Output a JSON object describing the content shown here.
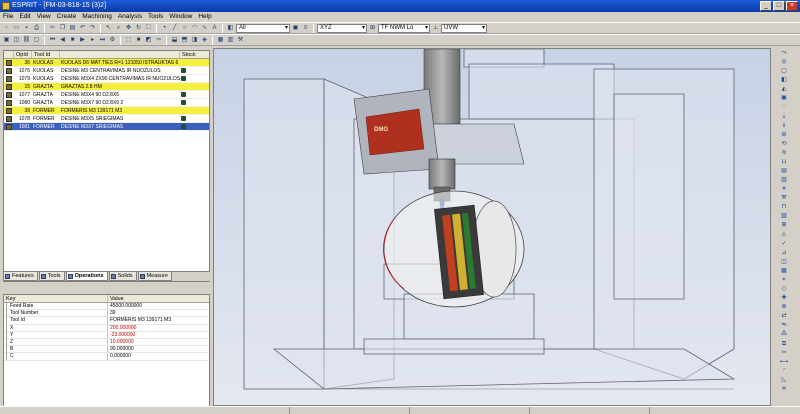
{
  "window": {
    "title": "ESPRIT - [FM-03-818-15 (3)2]",
    "buttons": [
      "_",
      "□",
      "×"
    ]
  },
  "menu": [
    "File",
    "Edit",
    "View",
    "Create",
    "Machining",
    "Analysis",
    "Tools",
    "Window",
    "Help"
  ],
  "toolbar": {
    "layer_combo": "All",
    "plane_combo": "XYZ",
    "view_combo": "TF NWM Lo",
    "uvw_combo": "UVW"
  },
  "operations": {
    "columns": [
      "OpId",
      "Tool Id",
      "",
      "Stock"
    ],
    "rows": [
      {
        "opid": "36",
        "tool": "KUOLAS",
        "name": "KUOLAS D6 MAT TIES R=1 121050 ISTRAUKTAS 6",
        "stock": false,
        "style": "yellow"
      },
      {
        "opid": "1076",
        "tool": "KUOLAS",
        "name": "DESINE M3 CENTRAVIMAS IR NUOZULOS",
        "stock": true,
        "style": ""
      },
      {
        "opid": "1079",
        "tool": "KUOLAS",
        "name": "DESINE M3X4 ZX90 CENTRAVIMAS IR NUOZULOS",
        "stock": true,
        "style": ""
      },
      {
        "opid": "15",
        "tool": "GRAZTA",
        "name": "GRAZTAS 2.8 HM",
        "stock": false,
        "style": "yellow"
      },
      {
        "opid": "1077",
        "tool": "GRAZTA",
        "name": "DESINE M3X4 90 D2.8X5",
        "stock": true,
        "style": ""
      },
      {
        "opid": "1080",
        "tool": "GRAZTA",
        "name": "DESINE M3X7 90 D2.8X9 2",
        "stock": true,
        "style": ""
      },
      {
        "opid": "39",
        "tool": "FORMER",
        "name": "FORMERIS M3 139171 M3",
        "stock": false,
        "style": "yellow"
      },
      {
        "opid": "1078",
        "tool": "FORMER",
        "name": "DESINE M3X5 SRIEGIMAS",
        "stock": true,
        "style": ""
      },
      {
        "opid": "1081",
        "tool": "FORMER",
        "name": "DESINE M3X7 SRIEGIMAS",
        "stock": true,
        "style": "selected"
      }
    ]
  },
  "tabs": [
    "Features",
    "Tools",
    "Operations",
    "Solids",
    "Measure"
  ],
  "active_tab": "Operations",
  "properties": {
    "head_key": "Key",
    "head_value": "Value",
    "rows": [
      {
        "key": "Feed Rate",
        "value": "45000.000000",
        "red": false
      },
      {
        "key": "Tool Number",
        "value": "39",
        "red": false
      },
      {
        "key": "Tool Id",
        "value": "FORMERIS   M3 139171 M3",
        "red": false
      },
      {
        "key": "X",
        "value": "200.000000",
        "red": true
      },
      {
        "key": "Y",
        "value": "-23.000000",
        "red": true
      },
      {
        "key": "Z",
        "value": "10.000000",
        "red": true
      },
      {
        "key": "B",
        "value": "90.000000",
        "red": false
      },
      {
        "key": "C",
        "value": "0.000000",
        "red": false
      }
    ]
  },
  "viewport": {
    "machine_label": "DMG"
  },
  "colors": {
    "row_yellow": "#f6ef3c",
    "row_selected": "#3a5fbc",
    "title_blue": "#1c5bd6",
    "viewport_bg": "#cfd8e8"
  }
}
